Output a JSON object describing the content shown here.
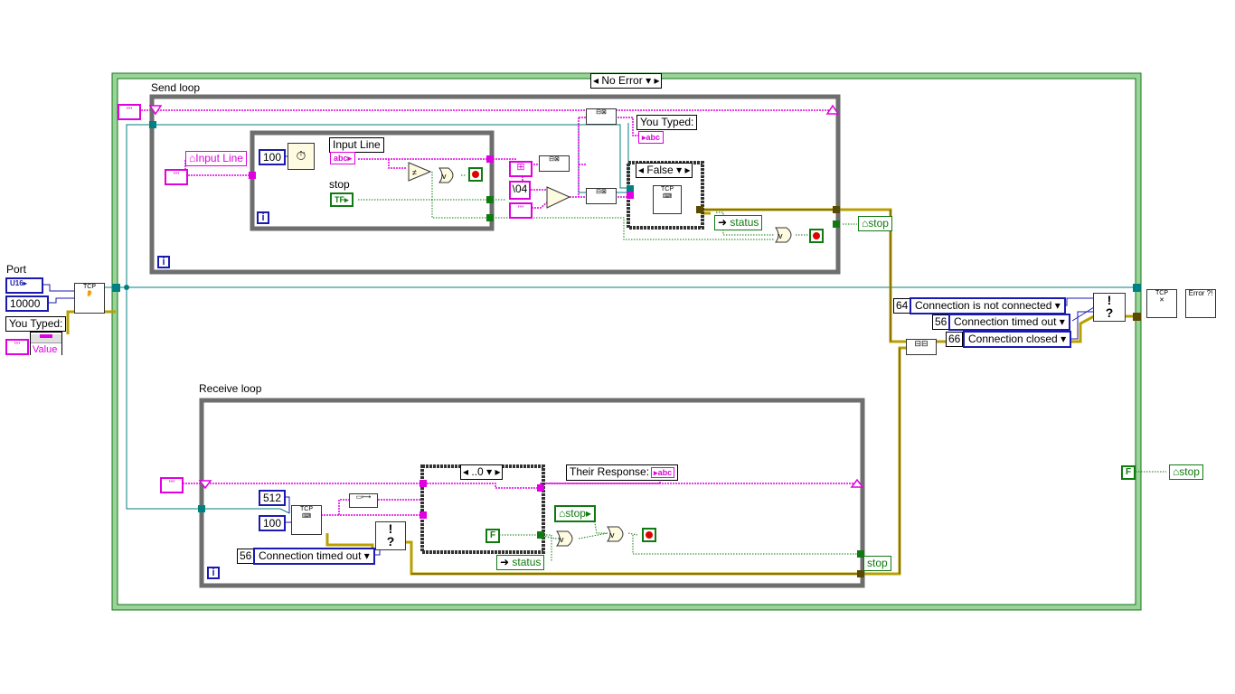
{
  "outer_case": {
    "selector": "No Error"
  },
  "send_loop": {
    "label": "Send loop",
    "wait_ms": "100",
    "input_line_label": "Input Line",
    "input_line_local": "Input Line",
    "stop_label": "stop",
    "crlf_const": "\\04",
    "case_selector": "False",
    "you_typed_label": "You Typed:",
    "status_label": "status",
    "stop_local": "stop",
    "iteration": "i"
  },
  "receive_loop": {
    "label": "Receive loop",
    "bytes_to_read": "512",
    "timeout_ms": "100",
    "error_code": "56",
    "error_ring": "Connection timed out",
    "case_selector": "..0",
    "their_response_label": "Their Response:",
    "stop_local": "stop",
    "false_const": "F",
    "status_label": "status",
    "stop_term": "stop",
    "iteration": "i"
  },
  "left_side": {
    "port_label": "Port",
    "port_type": "U16",
    "port_value": "10000",
    "you_typed_label": "You Typed:",
    "value_prop": "Value"
  },
  "error_filter": {
    "codes": [
      {
        "code": "64",
        "ring": "Connection is not connected"
      },
      {
        "code": "56",
        "ring": "Connection timed out"
      },
      {
        "code": "66",
        "ring": "Connection closed"
      }
    ]
  },
  "right_side": {
    "false_const": "F",
    "stop_local": "stop",
    "error_icon_text": "Error ?!"
  },
  "colors": {
    "string_wire": "#e000e0",
    "boolean_wire": "#0f7a0f",
    "numeric_wire": "#1a1ab0",
    "refnum_wire": "#008080",
    "error_wire": "#c8b400",
    "loop_border": "#6e6e6e",
    "case_border": "#9bd29b"
  }
}
